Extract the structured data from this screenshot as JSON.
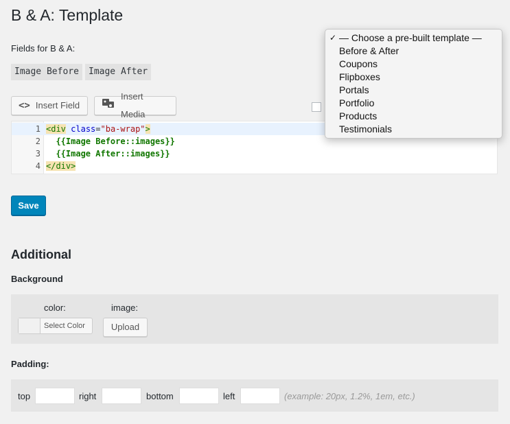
{
  "page": {
    "title": "B & A: Template"
  },
  "fields": {
    "label": "Fields for B & A:",
    "tags": [
      "Image Before",
      "Image After"
    ]
  },
  "toolbar": {
    "insert_field": "Insert Field",
    "insert_media": "Insert Media"
  },
  "editor": {
    "lines": [
      {
        "num": "1",
        "open": "<div",
        "attr": "class",
        "eq": "=",
        "str": "\"ba-wrap\"",
        "close": ">"
      },
      {
        "num": "2",
        "text": "  {{Image Before::images}}"
      },
      {
        "num": "3",
        "text": "  {{Image After::images}}"
      },
      {
        "num": "4",
        "tag": "</div>"
      }
    ]
  },
  "save_label": "Save",
  "additional": {
    "heading": "Additional",
    "background_label": "Background",
    "color_label": "color:",
    "select_color": "Select Color",
    "image_label": "image:",
    "upload": "Upload",
    "padding_label": "Padding:",
    "top": "top",
    "right": "right",
    "bottom": "bottom",
    "left": "left",
    "hint": "(example: 20px, 1.2%, 1em, etc.)"
  },
  "template_dropdown": {
    "options": [
      "— Choose a pre-built template —",
      "Before & After",
      "Coupons",
      "Flipboxes",
      "Portals",
      "Portfolio",
      "Products",
      "Testimonials"
    ],
    "selected_index": 0,
    "check_mark": "✓"
  },
  "colors": {
    "primary": "#0085ba",
    "background": "#f1f1f1",
    "panel": "#e5e5e5"
  }
}
